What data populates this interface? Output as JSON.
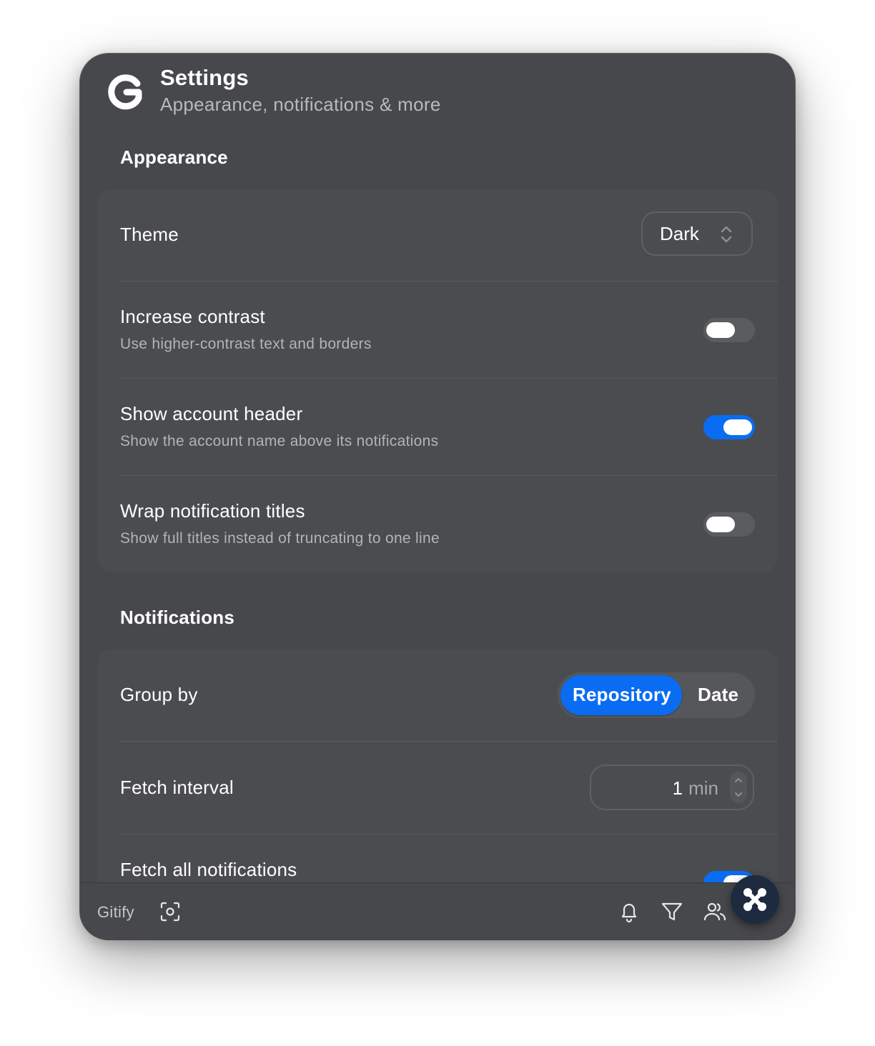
{
  "header": {
    "title": "Settings",
    "subtitle": "Appearance, notifications & more",
    "logo_icon": "gitify-logo-icon"
  },
  "appearance": {
    "section_title": "Appearance",
    "theme": {
      "label": "Theme",
      "value": "Dark"
    },
    "increase_contrast": {
      "label": "Increase contrast",
      "description": "Use higher-contrast text and borders",
      "enabled": false
    },
    "show_account_header": {
      "label": "Show account header",
      "description": "Show the account name above its notifications",
      "enabled": true
    },
    "wrap_titles": {
      "label": "Wrap notification titles",
      "description": "Show full titles instead of truncating to one line",
      "enabled": false
    }
  },
  "notifications": {
    "section_title": "Notifications",
    "group_by": {
      "label": "Group by",
      "options": [
        "Repository",
        "Date"
      ],
      "selected": "Repository"
    },
    "fetch_interval": {
      "label": "Fetch interval",
      "value": "1",
      "unit": "min"
    },
    "fetch_all": {
      "label": "Fetch all notifications",
      "enabled": true
    }
  },
  "footer": {
    "brand": "Gitify",
    "icons": [
      "screenshot-icon",
      "bell-icon",
      "filter-icon",
      "accounts-icon",
      "settings-badge-icon"
    ]
  },
  "colors": {
    "accent": "#0a6cf2",
    "window_bg": "#47484b",
    "card_bg": "#4b4c4f"
  }
}
